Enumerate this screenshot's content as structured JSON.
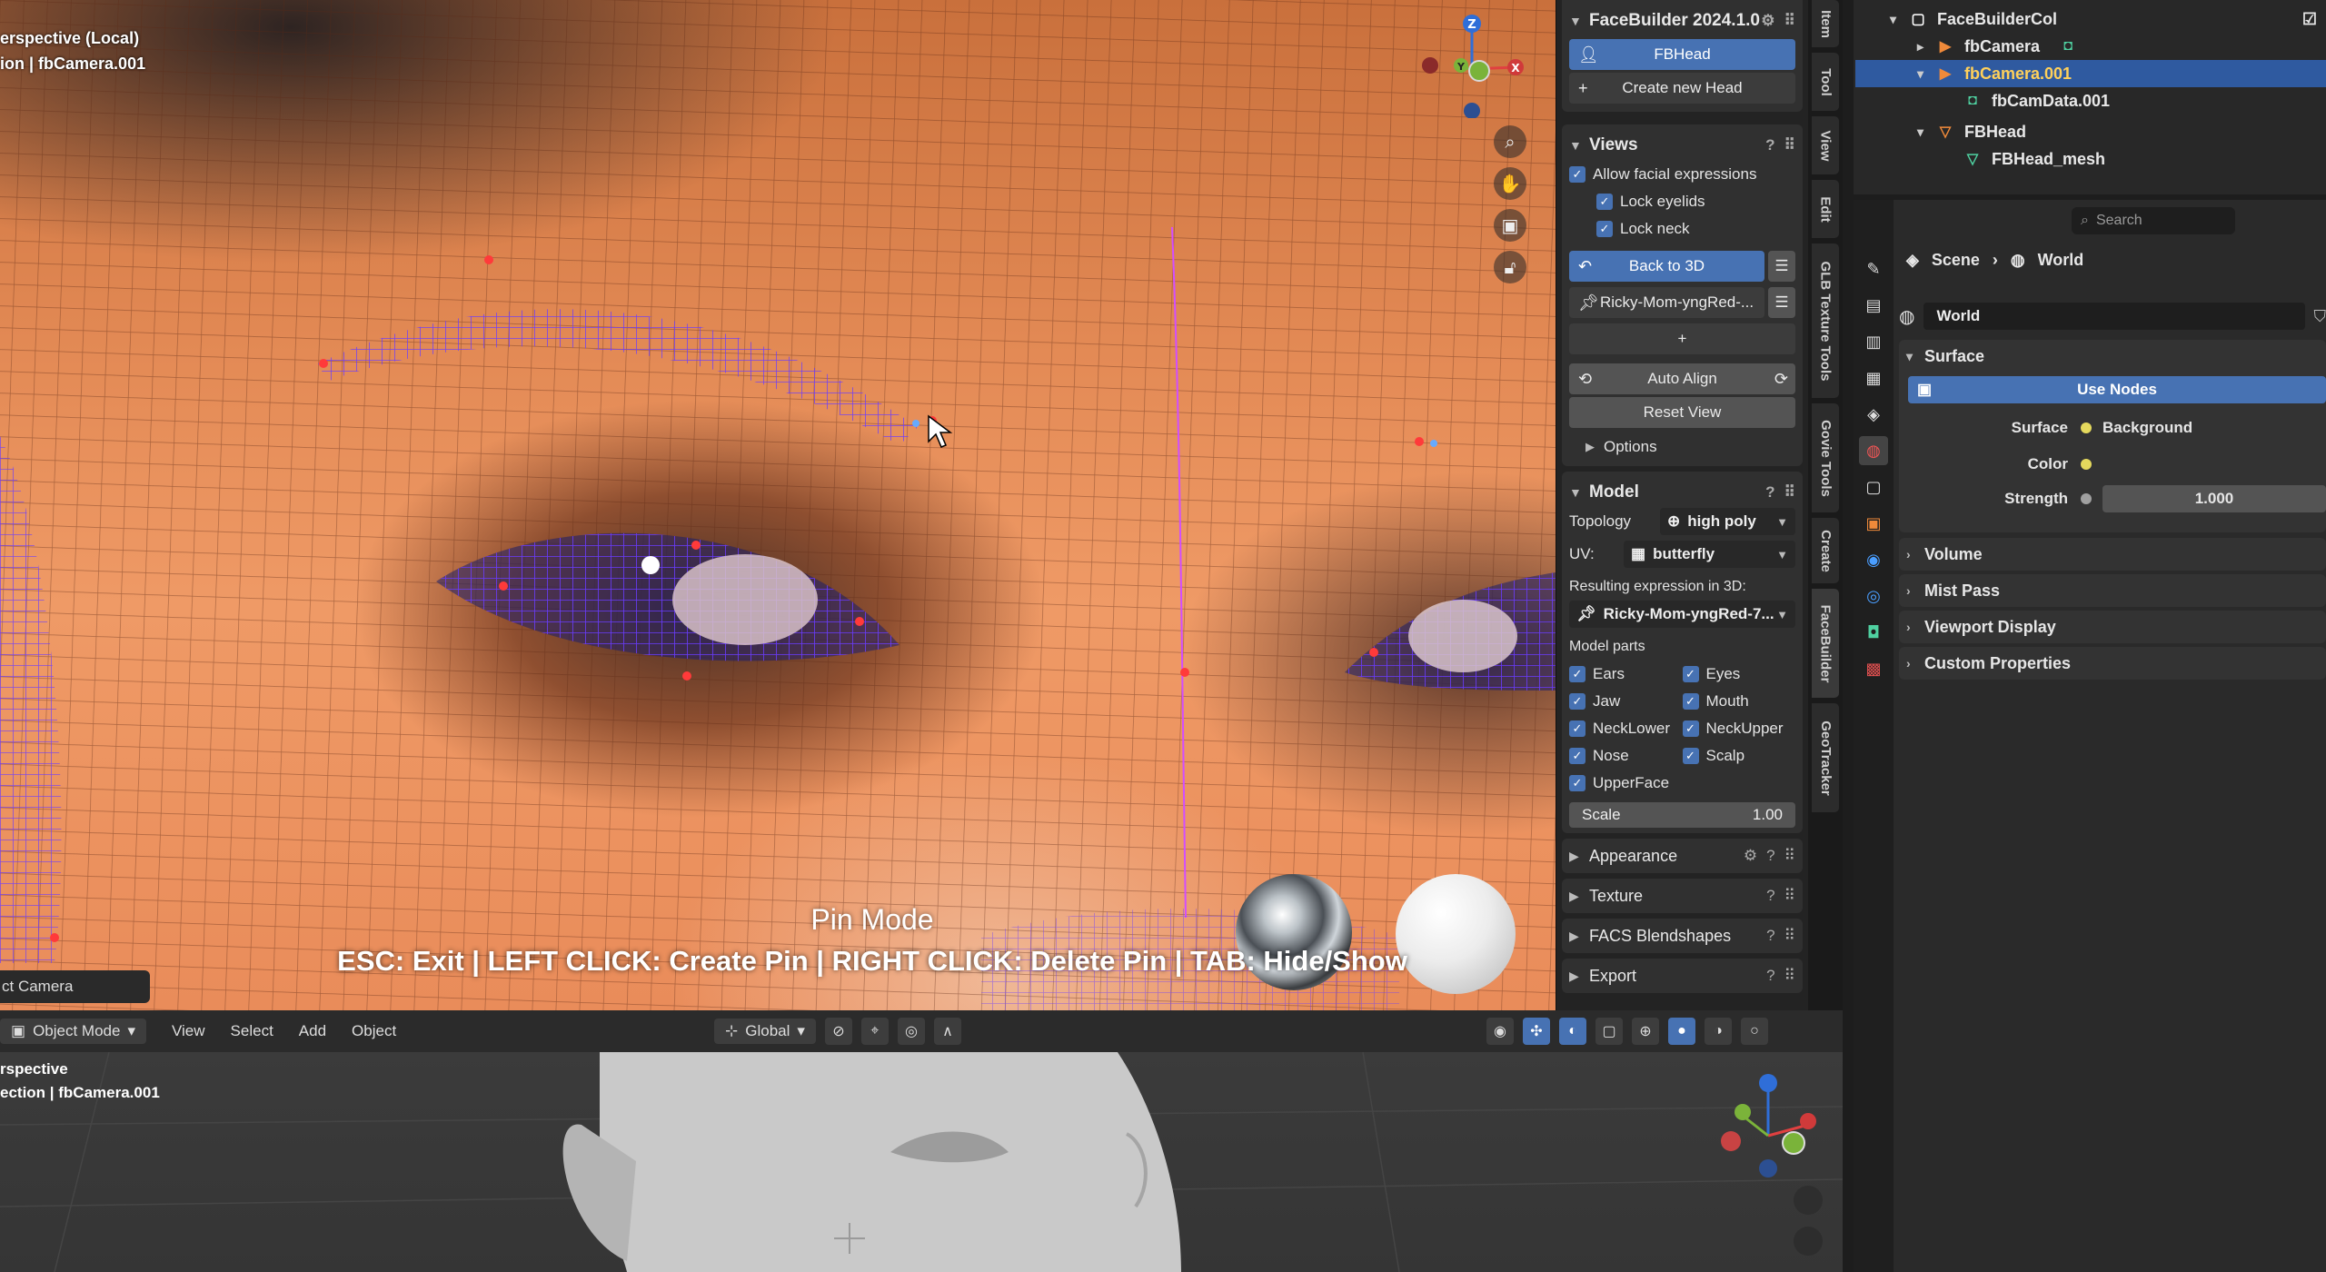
{
  "viewport_top": {
    "overlay_line1": "erspective (Local)",
    "overlay_line2": "ion | fbCamera.001",
    "camera_pill": "ct Camera",
    "pin_title": "Pin Mode",
    "pin_help": "ESC: Exit | LEFT CLICK: Create Pin | RIGHT CLICK: Delete Pin | TAB: Hide/Show"
  },
  "facebuilder": {
    "title": "FaceBuilder 2024.1.0",
    "head_button": "FBHead",
    "create_head": "Create new Head",
    "views": {
      "title": "Views",
      "allow_expressions": "Allow facial expressions",
      "lock_eyelids": "Lock eyelids",
      "lock_neck": "Lock neck",
      "back_to_3d": "Back to 3D",
      "image_name": "Ricky-Mom-yngRed-...",
      "add": "+",
      "auto_align": "Auto Align",
      "reset_view": "Reset View",
      "options": "Options"
    },
    "model": {
      "title": "Model",
      "topology_label": "Topology",
      "topology_value": "high poly",
      "uv_label": "UV:",
      "uv_value": "butterfly",
      "resulting_label": "Resulting expression in 3D:",
      "resulting_value": "Ricky-Mom-yngRed-7...",
      "parts_label": "Model parts",
      "parts": [
        "Ears",
        "Eyes",
        "Jaw",
        "Mouth",
        "NeckLower",
        "NeckUpper",
        "Nose",
        "Scalp",
        "UpperFace"
      ],
      "scale_label": "Scale",
      "scale_value": "1.00"
    },
    "collapsed": [
      "Appearance",
      "Texture",
      "FACS Blendshapes",
      "Export"
    ]
  },
  "vertical_tabs": [
    "Item",
    "Tool",
    "View",
    "Edit",
    "GLB Texture Tools",
    "Govie Tools",
    "Create",
    "FaceBuilder",
    "GeoTracker"
  ],
  "bottom_header": {
    "mode": "Object Mode",
    "menus": [
      "View",
      "Select",
      "Add",
      "Object"
    ],
    "orientation": "Global"
  },
  "viewport_bottom": {
    "overlay_line1": "rspective",
    "overlay_line2": "ection | fbCamera.001"
  },
  "outliner": {
    "rows": [
      {
        "label": "FaceBuilderCol",
        "icon": "collection-icon"
      },
      {
        "label": "fbCamera",
        "icon": "camera-icon"
      },
      {
        "label": "fbCamera.001",
        "icon": "camera-icon",
        "selected": true
      },
      {
        "label": "fbCamData.001",
        "icon": "camera-data-icon"
      },
      {
        "label": "FBHead",
        "icon": "mesh-object-icon"
      },
      {
        "label": "FBHead_mesh",
        "icon": "mesh-data-icon"
      }
    ]
  },
  "properties": {
    "search_placeholder": "Search",
    "crumb_scene": "Scene",
    "crumb_world": "World",
    "world_field": "World",
    "surface_title": "Surface",
    "use_nodes": "Use Nodes",
    "surface_label": "Surface",
    "surface_value": "Background",
    "color_label": "Color",
    "strength_label": "Strength",
    "strength_value": "1.000",
    "collapsed": [
      "Volume",
      "Mist Pass",
      "Viewport Display",
      "Custom Properties"
    ]
  },
  "colors": {
    "accent_blue": "#4772b3",
    "selection_blue": "#2f5aa0",
    "socket_yellow": "#e5d95d",
    "mesh_wire": "#6a3bff"
  }
}
